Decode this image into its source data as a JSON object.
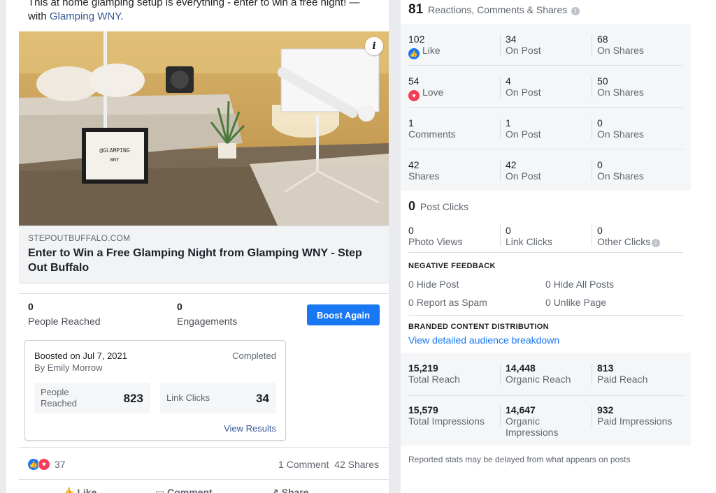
{
  "post": {
    "text_line1": "This at home glamping setup is everything - enter to win a free night! —",
    "text_with": "with ",
    "text_link": "Glamping WNY",
    "text_end": ".",
    "image_sign_line1": "@GLAMPING",
    "image_sign_line2": "WNY",
    "link_domain": "STEPOUTBUFFALO.COM",
    "link_title": "Enter to Win a Free Glamping Night from Glamping WNY - Step Out Buffalo",
    "people_reached_value": "0",
    "people_reached_label": "People Reached",
    "engagements_value": "0",
    "engagements_label": "Engagements",
    "boost_button_label": "Boost Again",
    "boost_card": {
      "date": "Boosted on Jul 7, 2021",
      "by": "By Emily Morrow",
      "status": "Completed",
      "reached_label_1": "People",
      "reached_label_2": "Reached",
      "reached_value": "823",
      "clicks_label": "Link Clicks",
      "clicks_value": "34",
      "view_results": "View Results"
    },
    "reaction_count": "37",
    "comments": "1 Comment",
    "shares": "42 Shares",
    "actions": {
      "like": "Like",
      "comment": "Comment",
      "share": "Share"
    }
  },
  "panel": {
    "header_value": "81",
    "header_label": "Reactions, Comments & Shares",
    "rows": [
      {
        "total": "102",
        "label": "Like",
        "icon": "like",
        "on_post": "34",
        "on_post_label": "On Post",
        "on_shares": "68",
        "on_shares_label": "On Shares"
      },
      {
        "total": "54",
        "label": "Love",
        "icon": "love",
        "on_post": "4",
        "on_post_label": "On Post",
        "on_shares": "50",
        "on_shares_label": "On Shares"
      },
      {
        "total": "1",
        "label": "Comments",
        "icon": "",
        "on_post": "1",
        "on_post_label": "On Post",
        "on_shares": "0",
        "on_shares_label": "On Shares"
      },
      {
        "total": "42",
        "label": "Shares",
        "icon": "",
        "on_post": "42",
        "on_post_label": "On Post",
        "on_shares": "0",
        "on_shares_label": "On Shares"
      }
    ],
    "post_clicks_value": "0",
    "post_clicks_label": "Post Clicks",
    "photo_views_value": "0",
    "photo_views_label": "Photo Views",
    "link_clicks_value": "0",
    "link_clicks_label": "Link Clicks",
    "other_clicks_value": "0",
    "other_clicks_label": "Other Clicks",
    "negative_title": "NEGATIVE FEEDBACK",
    "hide_post_value": "0",
    "hide_post_label": "Hide Post",
    "hide_all_value": "0",
    "hide_all_label": "Hide All Posts",
    "spam_value": "0",
    "spam_label": "Report as Spam",
    "unlike_value": "0",
    "unlike_label": "Unlike Page",
    "branded_title": "BRANDED CONTENT DISTRIBUTION",
    "branded_link": "View detailed audience breakdown",
    "total_reach_value": "15,219",
    "total_reach_label": "Total Reach",
    "organic_reach_value": "14,448",
    "organic_reach_label": "Organic Reach",
    "paid_reach_value": "813",
    "paid_reach_label": "Paid Reach",
    "total_impr_value": "15,579",
    "total_impr_label": "Total Impressions",
    "organic_impr_value": "14,647",
    "organic_impr_label_1": "Organic",
    "organic_impr_label_2": "Impressions",
    "paid_impr_value": "932",
    "paid_impr_label": "Paid Impressions",
    "footer": "Reported stats may be delayed from what appears on posts"
  },
  "colors": {
    "accent": "#1877f2",
    "like": "#1877f2",
    "love": "#f33e58",
    "link": "#385898"
  }
}
